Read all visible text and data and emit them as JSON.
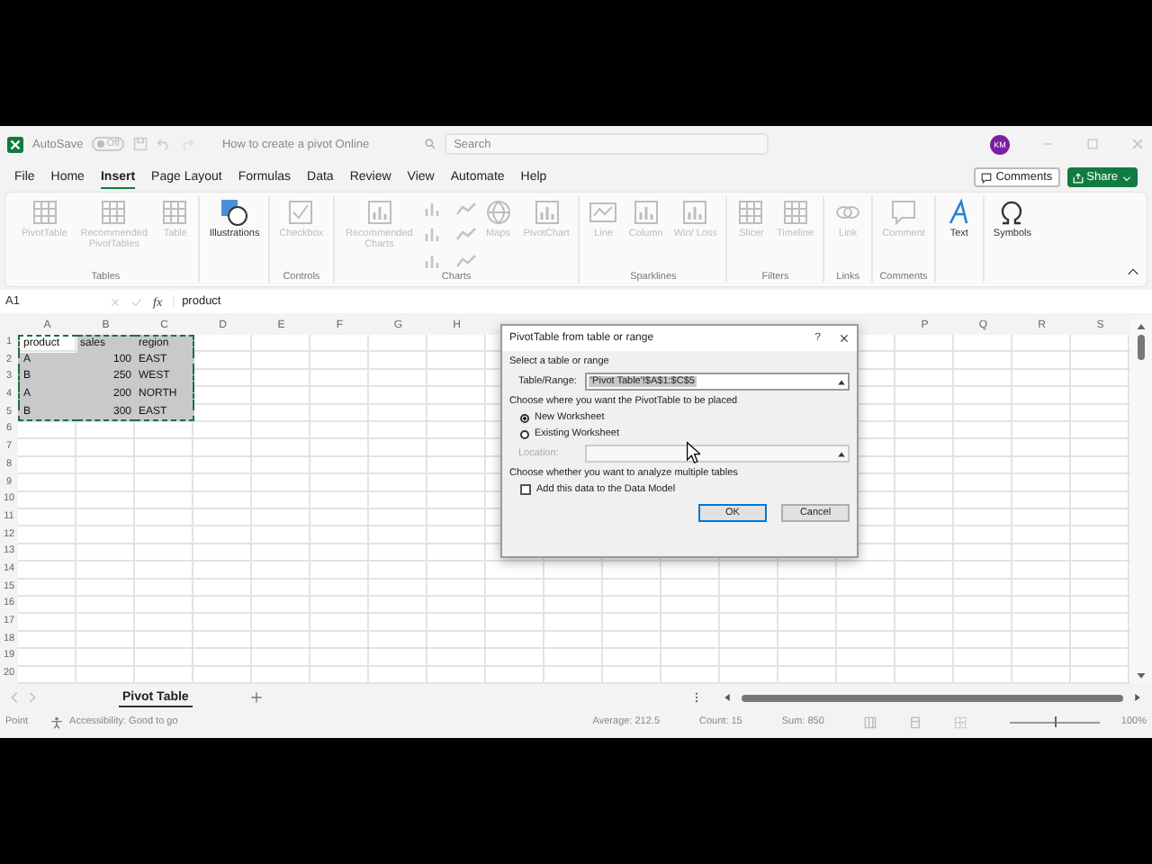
{
  "title_bar": {
    "autosave_label": "AutoSave",
    "autosave_state": "Off",
    "document_title": "How to create a pivot Online",
    "search": {
      "placeholder": "Search"
    },
    "avatar": "KM"
  },
  "menu_tabs": [
    {
      "label": "File",
      "selected": false
    },
    {
      "label": "Home",
      "selected": false
    },
    {
      "label": "Insert",
      "selected": true
    },
    {
      "label": "Page Layout",
      "selected": false
    },
    {
      "label": "Formulas",
      "selected": false
    },
    {
      "label": "Data",
      "selected": false
    },
    {
      "label": "Review",
      "selected": false
    },
    {
      "label": "View",
      "selected": false
    },
    {
      "label": "Automate",
      "selected": false
    },
    {
      "label": "Help",
      "selected": false
    }
  ],
  "comments_button": "Comments",
  "share_button": "Share",
  "ribbon_groups": [
    {
      "label": "Tables",
      "items": [
        {
          "kind": "large",
          "label": "PivotTable",
          "disabled": true
        },
        {
          "kind": "large",
          "label": "Recommended PivotTables",
          "disabled": true
        },
        {
          "kind": "large",
          "label": "Table",
          "disabled": true
        }
      ]
    },
    {
      "items": [
        {
          "kind": "large",
          "label": "Illustrations",
          "disabled": false
        }
      ]
    },
    {
      "label": "Controls",
      "items": [
        {
          "kind": "large",
          "label": "Checkbox",
          "disabled": true
        }
      ]
    },
    {
      "label": "Charts",
      "items": [
        {
          "kind": "large",
          "label": "Recommended Charts",
          "disabled": true
        },
        {
          "kind": "gallery",
          "disabled": true
        },
        {
          "kind": "large",
          "label": "Maps",
          "disabled": true
        },
        {
          "kind": "large",
          "label": "PivotChart",
          "disabled": true
        }
      ]
    },
    {
      "label": "Sparklines",
      "items": [
        {
          "kind": "large",
          "label": "Line",
          "disabled": true
        },
        {
          "kind": "large",
          "label": "Column",
          "disabled": true
        },
        {
          "kind": "large",
          "label": "Win/ Loss",
          "disabled": true
        }
      ]
    },
    {
      "label": "Filters",
      "items": [
        {
          "kind": "large",
          "label": "Slicer",
          "disabled": true
        },
        {
          "kind": "large",
          "label": "Timeline",
          "disabled": true
        }
      ]
    },
    {
      "label": "Links",
      "items": [
        {
          "kind": "large",
          "label": "Link",
          "disabled": true
        }
      ]
    },
    {
      "label": "Comments",
      "items": [
        {
          "kind": "large",
          "label": "Comment",
          "disabled": true
        }
      ]
    },
    {
      "items": [
        {
          "kind": "large",
          "label": "Text",
          "disabled": false
        }
      ]
    },
    {
      "items": [
        {
          "kind": "large",
          "label": "Symbols",
          "disabled": false
        }
      ]
    }
  ],
  "formula_bar": {
    "name_box": "A1",
    "function_label": "fx",
    "content": "product"
  },
  "columns_left": [
    "A",
    "B",
    "C",
    "D",
    "E",
    "F",
    "G",
    "H"
  ],
  "columns_right": [
    "P",
    "Q",
    "R",
    "S"
  ],
  "row_numbers": [
    "1",
    "2",
    "3",
    "4",
    "5",
    "6",
    "7",
    "8",
    "9",
    "10",
    "11",
    "12",
    "13",
    "14",
    "15",
    "16",
    "17",
    "18",
    "19",
    "20"
  ],
  "rows": [
    {
      "selected": true,
      "cells": [
        {
          "text": "product",
          "active": true,
          "kind": "text"
        },
        {
          "text": "sales",
          "active": false,
          "kind": "text"
        },
        {
          "text": "region",
          "active": false,
          "kind": "text"
        }
      ]
    },
    {
      "selected": true,
      "cells": [
        {
          "text": "A",
          "active": false,
          "kind": "text"
        },
        {
          "text": "100",
          "active": false,
          "kind": "number"
        },
        {
          "text": "EAST",
          "active": false,
          "kind": "text"
        }
      ]
    },
    {
      "selected": true,
      "cells": [
        {
          "text": "B",
          "active": false,
          "kind": "text"
        },
        {
          "text": "250",
          "active": false,
          "kind": "number"
        },
        {
          "text": "WEST",
          "active": false,
          "kind": "text"
        }
      ]
    },
    {
      "selected": true,
      "cells": [
        {
          "text": "A",
          "active": false,
          "kind": "text"
        },
        {
          "text": "200",
          "active": false,
          "kind": "number"
        },
        {
          "text": "NORTH",
          "active": false,
          "kind": "text"
        }
      ]
    },
    {
      "selected": true,
      "cells": [
        {
          "text": "B",
          "active": false,
          "kind": "text"
        },
        {
          "text": "300",
          "active": false,
          "kind": "number"
        },
        {
          "text": "EAST",
          "active": false,
          "kind": "text"
        }
      ]
    }
  ],
  "sheet_tabs": [
    {
      "label": "Pivot Table",
      "selected": true
    }
  ],
  "dialog": {
    "title": "PivotTable from table or range",
    "help": "?",
    "section_1": "Select a table or range",
    "range_label": "Table/Range:",
    "range_value": "'Pivot Table'!$A$1:$C$5",
    "range_value_selected": true,
    "section_2": "Choose where you want the PivotTable to be placed",
    "placements": [
      {
        "label": "New Worksheet",
        "selected": true
      },
      {
        "label": "Existing Worksheet",
        "selected": false
      }
    ],
    "location": {
      "label": "Location:",
      "disabled": true
    },
    "section_3": "Choose whether you want to analyze multiple tables",
    "data_model": {
      "label": "Add this data to the Data Model",
      "checked": false
    },
    "buttons": [
      {
        "label": "OK",
        "default": true
      },
      {
        "label": "Cancel",
        "default": false
      }
    ]
  },
  "status_bar": {
    "mode": "Point",
    "accessibility": "Accessibility: Good to go",
    "stats": [
      "Average: 212.5",
      "Count: 15",
      "Sum: 850"
    ],
    "zoom": {
      "level": 0.5,
      "reading": "100%"
    }
  }
}
